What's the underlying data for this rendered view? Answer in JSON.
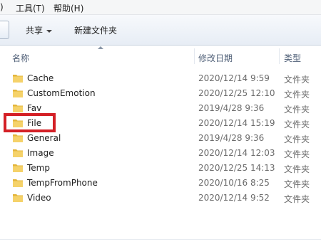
{
  "menu": {
    "partial": ")",
    "tools": "工具(T)",
    "help": "帮助(H)"
  },
  "toolbar": {
    "share": "共享",
    "new_folder": "新建文件夹"
  },
  "columns": {
    "name": "名称",
    "date": "修改日期",
    "type": "类型"
  },
  "rows": [
    {
      "name": "Cache",
      "date": "2020/12/14 9:59",
      "type": "文件夹"
    },
    {
      "name": "CustomEmotion",
      "date": "2020/12/25 12:10",
      "type": "文件夹"
    },
    {
      "name": "Fav",
      "date": "2019/4/28 9:36",
      "type": "文件夹"
    },
    {
      "name": "File",
      "date": "2020/12/14 15:19",
      "type": "文件夹"
    },
    {
      "name": "General",
      "date": "2019/4/28 9:36",
      "type": "文件夹"
    },
    {
      "name": "Image",
      "date": "2020/12/14 12:03",
      "type": "文件夹"
    },
    {
      "name": "Temp",
      "date": "2020/12/25 14:13",
      "type": "文件夹"
    },
    {
      "name": "TempFromPhone",
      "date": "2020/10/16 8:25",
      "type": "文件夹"
    },
    {
      "name": "Video",
      "date": "2020/12/14 9:52",
      "type": "文件夹"
    }
  ],
  "colors": {
    "highlight": "#d42026",
    "folder": "#f2c94c"
  }
}
